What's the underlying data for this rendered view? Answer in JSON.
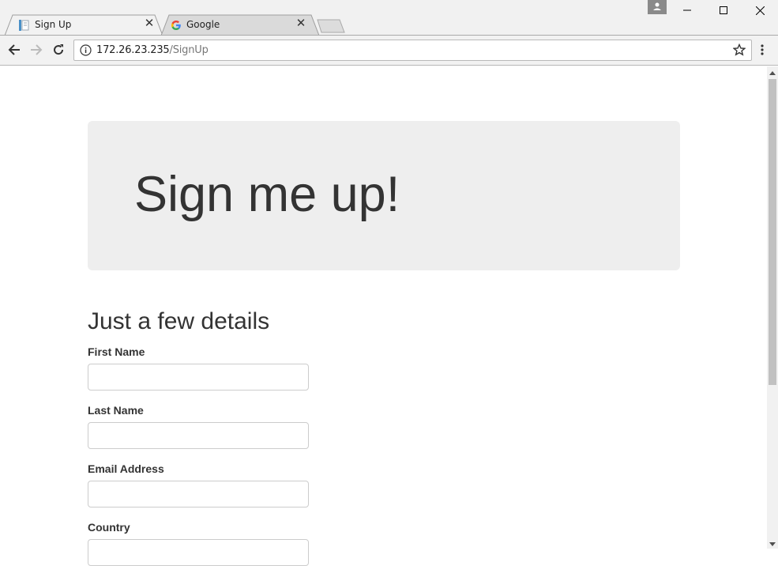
{
  "browser": {
    "tabs": [
      {
        "title": "Sign Up",
        "active": true
      },
      {
        "title": "Google",
        "active": false
      }
    ],
    "address": {
      "host": "172.26.23.235",
      "path": "/SignUp"
    }
  },
  "page": {
    "hero_title": "Sign me up!",
    "section_title": "Just a few details",
    "fields": [
      {
        "label": "First Name",
        "value": ""
      },
      {
        "label": "Last Name",
        "value": ""
      },
      {
        "label": "Email Address",
        "value": ""
      },
      {
        "label": "Country",
        "value": ""
      }
    ]
  },
  "colors": {
    "jumbotron_bg": "#eeeeee",
    "text": "#333333",
    "input_border": "#cccccc"
  }
}
